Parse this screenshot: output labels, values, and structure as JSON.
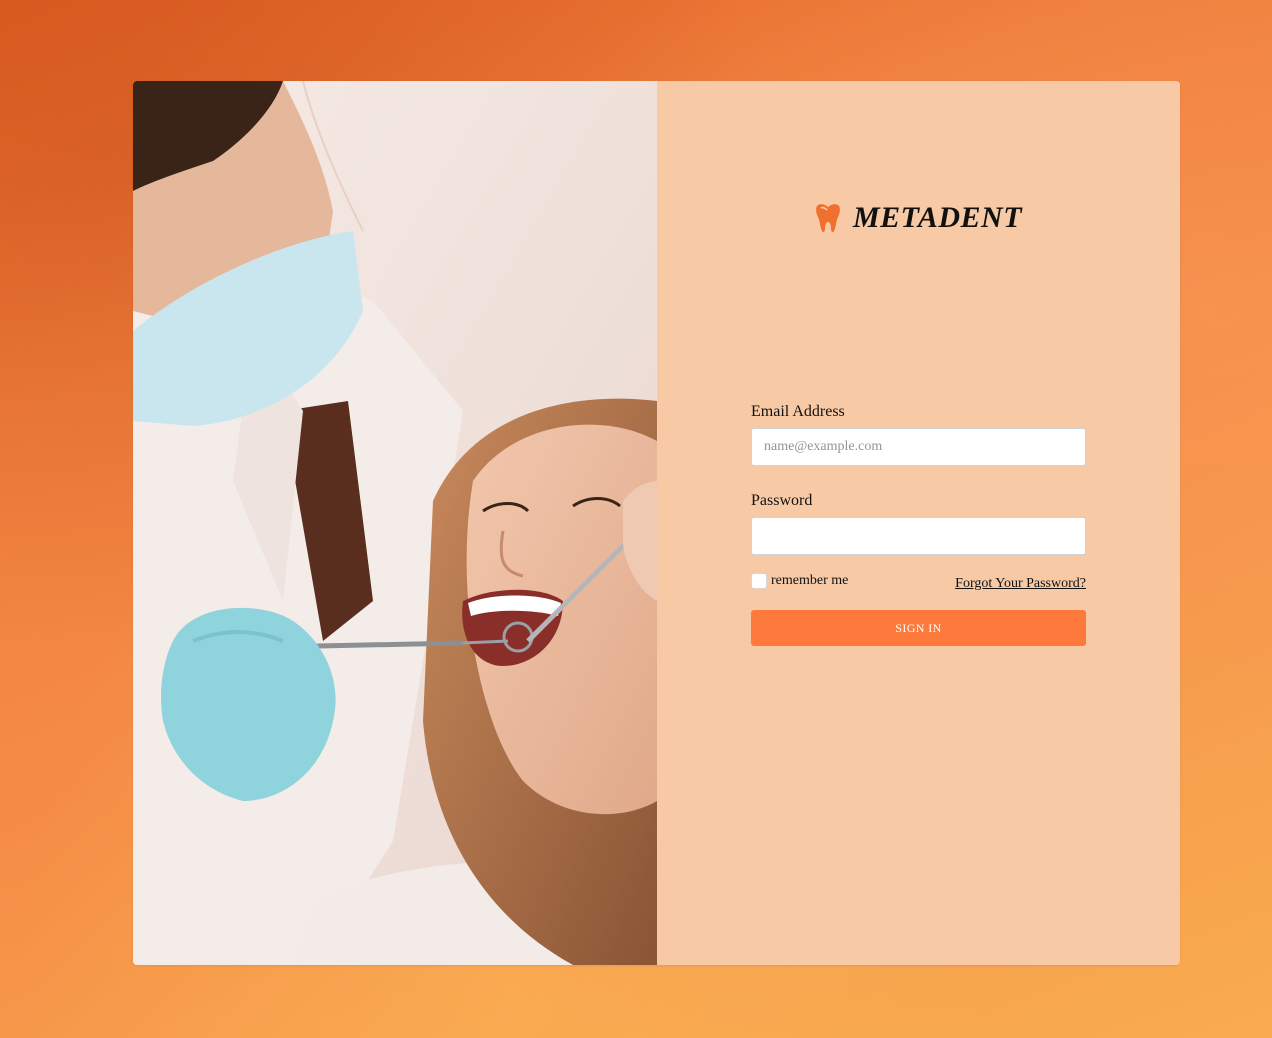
{
  "brand": {
    "name": "METADENT",
    "icon": "tooth-icon",
    "icon_color": "#f07030"
  },
  "hero_image": {
    "icon": "dentist-patient-photo"
  },
  "form": {
    "email_label": "Email Address",
    "email_placeholder": "name@example.com",
    "email_value": "",
    "password_label": "Password",
    "password_value": "",
    "remember_label": "remember me",
    "remember_checked": false,
    "forgot_label": "Forgot Your Password?",
    "submit_label": "SIGN IN"
  },
  "colors": {
    "page_background": "#f08a45",
    "form_panel": "#f7c9a4",
    "accent": "#fd7a3c"
  }
}
